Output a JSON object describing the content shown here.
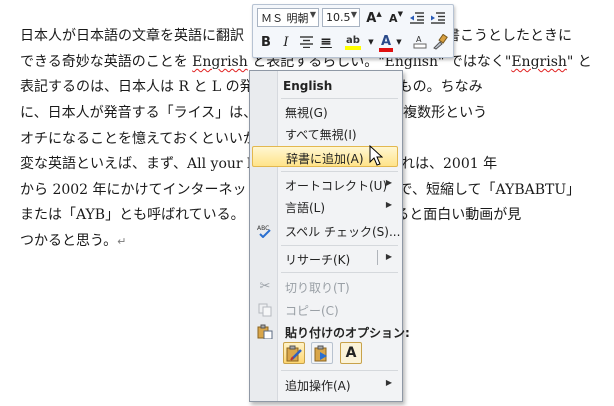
{
  "document": {
    "lines": [
      {
        "a": "日本人が日本語の文章を英語に翻訳",
        "b": "を書こうとしたときに"
      },
      {
        "a": "できる奇妙な英語のことを ",
        "sq1": "Engrish",
        "b": " と表記するらしい。\"English\" ではなく\"",
        "sq2": "Engrish",
        "c": "\" と"
      },
      {
        "a": "表記するのは、日本人は R と L の発",
        "b": "う洒落みたいなもの。ちなみ"
      },
      {
        "a": "に、日本人が発音する「ライス」は、",
        "b": "聞こえ、シラミの複数形という"
      },
      {
        "a": "オチになることを憶えておくといいか"
      },
      {
        "a": "変な英語といえば、まず、All your b",
        "b": "挙げられる。これは、2001 年"
      },
      {
        "a": "から 2002 年にかけてインターネット",
        "b": "一つで、短縮して「AYBABTU」"
      },
      {
        "a": "または「AYB」とも呼ばれている。",
        "b": "索してみると面白い動画が見"
      },
      {
        "a": "つかると思う。"
      }
    ]
  },
  "mini_toolbar": {
    "font_name": "ＭＳ 明朝",
    "font_size": "10.5",
    "grow_font": "A",
    "shrink_font": "A",
    "bold": "B",
    "italic": "I",
    "center": "≡",
    "highlight_letter": "ab",
    "font_color_letter": "A",
    "highlight_color": "#ffff00",
    "font_color": "#e01010"
  },
  "context_menu": {
    "suggestion": "English",
    "items": [
      {
        "label": "無視(G)"
      },
      {
        "label": "すべて無視(I)"
      },
      {
        "label": "辞書に追加(A)"
      },
      {
        "label": "オートコレクト(U)"
      },
      {
        "label": "言語(L)"
      },
      {
        "label": "スペル チェック(S)..."
      },
      {
        "label": "リサーチ(K)"
      },
      {
        "label": "切り取り(T)"
      },
      {
        "label": "コピー(C)"
      },
      {
        "label": "追加操作(A)"
      }
    ],
    "paste_header": "貼り付けのオプション:",
    "paste_a_label": "A"
  },
  "colors": {
    "highlight_border": "#e3b84f",
    "spelling_squiggle": "#e02020"
  }
}
